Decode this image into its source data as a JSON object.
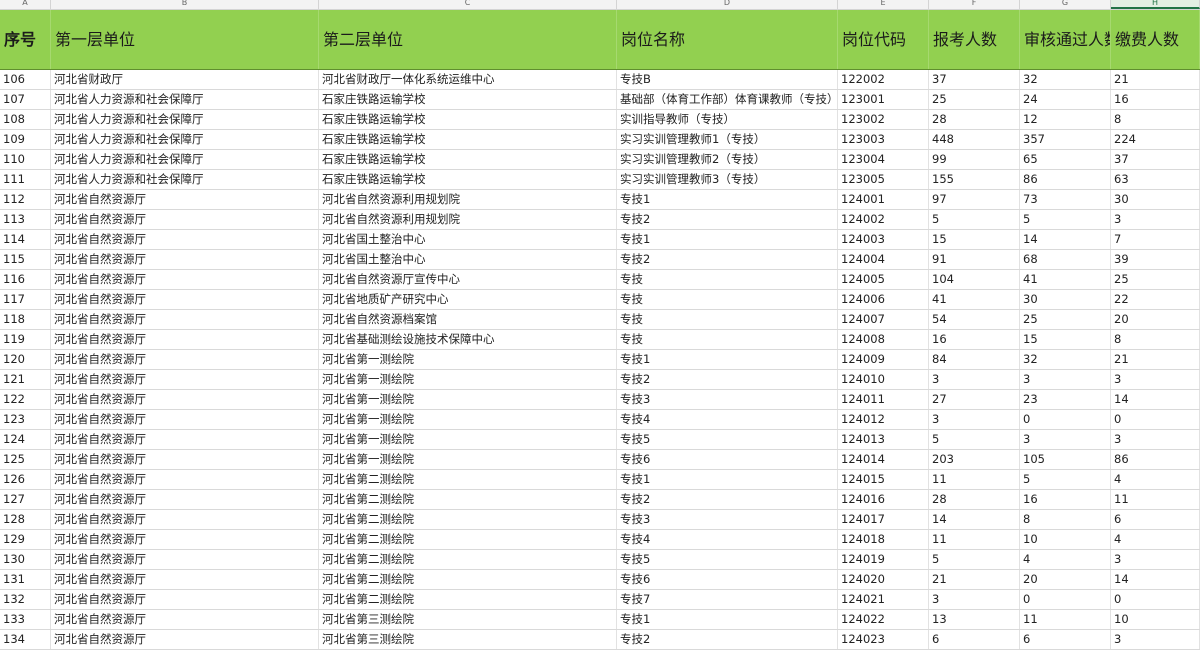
{
  "column_letters": [
    "A",
    "B",
    "C",
    "D",
    "E",
    "F",
    "G",
    "H"
  ],
  "header": [
    "序号",
    "第一层单位",
    "第二层单位",
    "岗位名称",
    "岗位代码",
    "报考人数",
    "审核通过人数",
    "缴费人数"
  ],
  "rows": [
    [
      "106",
      "河北省财政厅",
      "河北省财政厅一体化系统运维中心",
      "专技B",
      "122002",
      "37",
      "32",
      "21"
    ],
    [
      "107",
      "河北省人力资源和社会保障厅",
      "石家庄铁路运输学校",
      "基础部（体育工作部）体育课教师（专技）",
      "123001",
      "25",
      "24",
      "16"
    ],
    [
      "108",
      "河北省人力资源和社会保障厅",
      "石家庄铁路运输学校",
      "实训指导教师（专技）",
      "123002",
      "28",
      "12",
      "8"
    ],
    [
      "109",
      "河北省人力资源和社会保障厅",
      "石家庄铁路运输学校",
      "实习实训管理教师1（专技）",
      "123003",
      "448",
      "357",
      "224"
    ],
    [
      "110",
      "河北省人力资源和社会保障厅",
      "石家庄铁路运输学校",
      "实习实训管理教师2（专技）",
      "123004",
      "99",
      "65",
      "37"
    ],
    [
      "111",
      "河北省人力资源和社会保障厅",
      "石家庄铁路运输学校",
      "实习实训管理教师3（专技）",
      "123005",
      "155",
      "86",
      "63"
    ],
    [
      "112",
      "河北省自然资源厅",
      "河北省自然资源利用规划院",
      "专技1",
      "124001",
      "97",
      "73",
      "30"
    ],
    [
      "113",
      "河北省自然资源厅",
      "河北省自然资源利用规划院",
      "专技2",
      "124002",
      "5",
      "5",
      "3"
    ],
    [
      "114",
      "河北省自然资源厅",
      "河北省国土整治中心",
      "专技1",
      "124003",
      "15",
      "14",
      "7"
    ],
    [
      "115",
      "河北省自然资源厅",
      "河北省国土整治中心",
      "专技2",
      "124004",
      "91",
      "68",
      "39"
    ],
    [
      "116",
      "河北省自然资源厅",
      "河北省自然资源厅宣传中心",
      "专技",
      "124005",
      "104",
      "41",
      "25"
    ],
    [
      "117",
      "河北省自然资源厅",
      "河北省地质矿产研究中心",
      "专技",
      "124006",
      "41",
      "30",
      "22"
    ],
    [
      "118",
      "河北省自然资源厅",
      "河北省自然资源档案馆",
      "专技",
      "124007",
      "54",
      "25",
      "20"
    ],
    [
      "119",
      "河北省自然资源厅",
      "河北省基础测绘设施技术保障中心",
      "专技",
      "124008",
      "16",
      "15",
      "8"
    ],
    [
      "120",
      "河北省自然资源厅",
      "河北省第一测绘院",
      "专技1",
      "124009",
      "84",
      "32",
      "21"
    ],
    [
      "121",
      "河北省自然资源厅",
      "河北省第一测绘院",
      "专技2",
      "124010",
      "3",
      "3",
      "3"
    ],
    [
      "122",
      "河北省自然资源厅",
      "河北省第一测绘院",
      "专技3",
      "124011",
      "27",
      "23",
      "14"
    ],
    [
      "123",
      "河北省自然资源厅",
      "河北省第一测绘院",
      "专技4",
      "124012",
      "3",
      "0",
      "0"
    ],
    [
      "124",
      "河北省自然资源厅",
      "河北省第一测绘院",
      "专技5",
      "124013",
      "5",
      "3",
      "3"
    ],
    [
      "125",
      "河北省自然资源厅",
      "河北省第一测绘院",
      "专技6",
      "124014",
      "203",
      "105",
      "86"
    ],
    [
      "126",
      "河北省自然资源厅",
      "河北省第二测绘院",
      "专技1",
      "124015",
      "11",
      "5",
      "4"
    ],
    [
      "127",
      "河北省自然资源厅",
      "河北省第二测绘院",
      "专技2",
      "124016",
      "28",
      "16",
      "11"
    ],
    [
      "128",
      "河北省自然资源厅",
      "河北省第二测绘院",
      "专技3",
      "124017",
      "14",
      "8",
      "6"
    ],
    [
      "129",
      "河北省自然资源厅",
      "河北省第二测绘院",
      "专技4",
      "124018",
      "11",
      "10",
      "4"
    ],
    [
      "130",
      "河北省自然资源厅",
      "河北省第二测绘院",
      "专技5",
      "124019",
      "5",
      "4",
      "3"
    ],
    [
      "131",
      "河北省自然资源厅",
      "河北省第二测绘院",
      "专技6",
      "124020",
      "21",
      "20",
      "14"
    ],
    [
      "132",
      "河北省自然资源厅",
      "河北省第二测绘院",
      "专技7",
      "124021",
      "3",
      "0",
      "0"
    ],
    [
      "133",
      "河北省自然资源厅",
      "河北省第三测绘院",
      "专技1",
      "124022",
      "13",
      "11",
      "10"
    ],
    [
      "134",
      "河北省自然资源厅",
      "河北省第三测绘院",
      "专技2",
      "124023",
      "6",
      "6",
      "3"
    ]
  ]
}
